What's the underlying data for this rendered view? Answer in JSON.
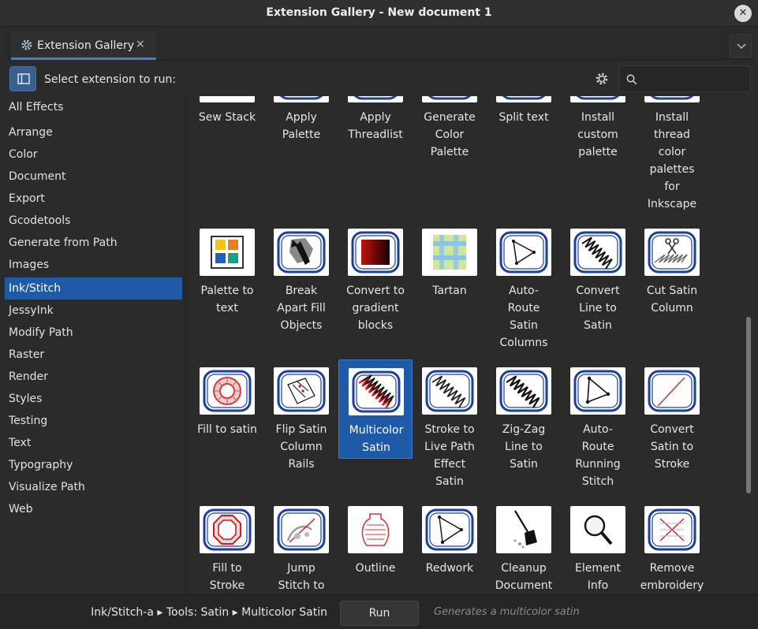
{
  "window": {
    "title": "Extension Gallery - New document 1",
    "close_label": "✕"
  },
  "tab": {
    "label": "Extension Gallery",
    "close_label": "×"
  },
  "toolbar": {
    "prompt": "Select extension to run:",
    "search_placeholder": ""
  },
  "sidebar": {
    "items": [
      {
        "label": "All Effects",
        "active": false
      },
      {
        "label": "Arrange",
        "active": false
      },
      {
        "label": "Color",
        "active": false
      },
      {
        "label": "Document",
        "active": false
      },
      {
        "label": "Export",
        "active": false
      },
      {
        "label": "Gcodetools",
        "active": false
      },
      {
        "label": "Generate from Path",
        "active": false
      },
      {
        "label": "Images",
        "active": false
      },
      {
        "label": "Ink/Stitch",
        "active": true
      },
      {
        "label": "JessyInk",
        "active": false
      },
      {
        "label": "Modify Path",
        "active": false
      },
      {
        "label": "Raster",
        "active": false
      },
      {
        "label": "Render",
        "active": false
      },
      {
        "label": "Styles",
        "active": false
      },
      {
        "label": "Testing",
        "active": false
      },
      {
        "label": "Text",
        "active": false
      },
      {
        "label": "Typography",
        "active": false
      },
      {
        "label": "Visualize Path",
        "active": false
      },
      {
        "label": "Web",
        "active": false
      }
    ]
  },
  "gallery": {
    "rows": [
      [
        {
          "label": "Sew Stack",
          "icon": "sew-stack-icon"
        },
        {
          "label": "Apply\nPalette",
          "icon": "apply-palette-icon"
        },
        {
          "label": "Apply\nThreadlist",
          "icon": "apply-threadlist-icon"
        },
        {
          "label": "Generate\nColor\nPalette",
          "icon": "generate-color-palette-icon"
        },
        {
          "label": "Split text",
          "icon": "split-text-icon"
        },
        {
          "label": "Install\ncustom\npalette",
          "icon": "install-custom-palette-icon"
        },
        {
          "label": "Install\nthread\ncolor\npalettes\nfor\nInkscape",
          "icon": "install-thread-palettes-icon"
        }
      ],
      [
        {
          "label": "Palette to\ntext",
          "icon": "palette-to-text-icon"
        },
        {
          "label": "Break\nApart Fill\nObjects",
          "icon": "wrench-icon"
        },
        {
          "label": "Convert to\ngradient\nblocks",
          "icon": "gradient-icon"
        },
        {
          "label": "Tartan",
          "icon": "tartan-icon"
        },
        {
          "label": "Auto-\nRoute\nSatin\nColumns",
          "icon": "auto-route-satin-icon"
        },
        {
          "label": "Convert\nLine to\nSatin",
          "icon": "line-to-satin-icon"
        },
        {
          "label": "Cut Satin\nColumn",
          "icon": "scissors-icon"
        }
      ],
      [
        {
          "label": "Fill to satin",
          "icon": "fill-to-satin-icon"
        },
        {
          "label": "Flip Satin\nColumn\nRails",
          "icon": "flip-satin-icon"
        },
        {
          "label": "Multicolor\nSatin",
          "icon": "multicolor-satin-icon",
          "selected": true
        },
        {
          "label": "Stroke to\nLive Path\nEffect\nSatin",
          "icon": "stroke-to-lpe-satin-icon"
        },
        {
          "label": "Zig-Zag\nLine to\nSatin",
          "icon": "zigzag-to-satin-icon"
        },
        {
          "label": "Auto-\nRoute\nRunning\nStitch",
          "icon": "auto-route-running-icon"
        },
        {
          "label": "Convert\nSatin to\nStroke",
          "icon": "satin-to-stroke-icon"
        }
      ],
      [
        {
          "label": "Fill to\nStroke",
          "icon": "fill-to-stroke-icon"
        },
        {
          "label": "Jump\nStitch to",
          "icon": "jump-stitch-icon"
        },
        {
          "label": "Outline",
          "icon": "outline-icon"
        },
        {
          "label": "Redwork",
          "icon": "redwork-icon"
        },
        {
          "label": "Cleanup\nDocument",
          "icon": "broom-icon"
        },
        {
          "label": "Element\nInfo",
          "icon": "magnifier-icon"
        },
        {
          "label": "Remove\nembroidery",
          "icon": "remove-embroidery-icon"
        }
      ]
    ]
  },
  "footer": {
    "path": "Ink/Stitch-a ▸ Tools: Satin ▸ Multicolor Satin",
    "run_label": "Run",
    "description": "Generates a multicolor satin"
  },
  "colors": {
    "accent": "#1f5aa8",
    "hoop_blue": "#1d3f9c",
    "background": "#2b2b2b"
  }
}
